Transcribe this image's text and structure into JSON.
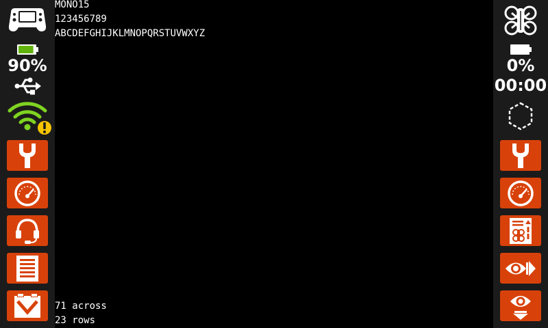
{
  "console": {
    "lines_top": [
      "MONO15",
      "123456789",
      "ABCDEFGHIJKLMNOPQRSTUVWXYZ"
    ],
    "lines_bottom": [
      "71 across",
      "23 rows"
    ]
  },
  "left_panel": {
    "battery_percent_label": "90%",
    "battery_level": 0.9,
    "tiles": [
      {
        "icon": "wrench-icon"
      },
      {
        "icon": "gauge-icon"
      },
      {
        "icon": "headset-icon"
      },
      {
        "icon": "document-list-icon"
      },
      {
        "icon": "inbox-tray-icon"
      }
    ]
  },
  "right_panel": {
    "battery_percent_label": "0%",
    "battery_level": 0.0,
    "timer": "00:00",
    "tiles": [
      {
        "icon": "wrench-icon"
      },
      {
        "icon": "gauge-icon"
      },
      {
        "icon": "drone-checklist-icon"
      },
      {
        "icon": "eye-forward-icon"
      },
      {
        "icon": "eye-down-icon"
      }
    ]
  },
  "colors": {
    "sidebar_bg": "#1b1b1b",
    "tile_orange": "#d8420a",
    "battery_green": "#62b30d",
    "wifi_green": "#7fd321",
    "warning_yellow": "#f5c400"
  }
}
